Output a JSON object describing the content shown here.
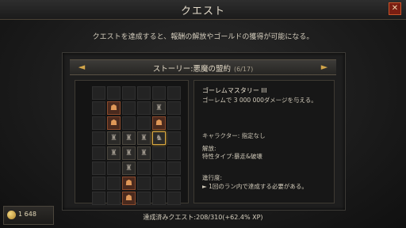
{
  "header": {
    "title": "クエスト",
    "close_label": "✕"
  },
  "subtitle": "クエストを達成すると、報酬の解放やゴールドの獲得が可能になる。",
  "story": {
    "label": "ストーリー:悪魔の盟約",
    "progress": "(6/17)",
    "prev_icon": "arrow-left-icon",
    "next_icon": "arrow-right-icon"
  },
  "quest_detail": {
    "name": "ゴーレムマスタリー III",
    "description": "ゴーレムで 3 000 000ダメージを与える。",
    "character_label": "キャラクター:",
    "character_value": "指定なし",
    "unlock_label": "解放:",
    "unlock_value": "特性タイプ:暴走&破壊",
    "progress_label": "進行度:",
    "progress_value": "► 1回のラン内で達成する必要がある。"
  },
  "gold": {
    "amount": "1 648",
    "icon": "coin-icon"
  },
  "completed": "達成済みクエスト:208/310(+62.4% XP)",
  "grid": {
    "rows": 8,
    "cols": 6,
    "cells": [
      "e",
      "e",
      "e",
      "e",
      "e",
      "e",
      "e",
      "r",
      "e",
      "e",
      "f",
      "e",
      "e",
      "r",
      "e",
      "e",
      "r",
      "e",
      "e",
      "f",
      "f",
      "f",
      "s",
      "e",
      "e",
      "f",
      "f",
      "f",
      "e",
      "e",
      "e",
      "e",
      "f",
      "e",
      "e",
      "e",
      "e",
      "e",
      "r",
      "e",
      "e",
      "e",
      "e",
      "e",
      "r",
      "e",
      "e",
      "e"
    ]
  }
}
